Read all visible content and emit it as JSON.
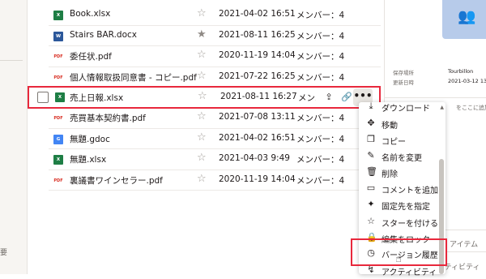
{
  "left_panel": {
    "stub_text": "要"
  },
  "files": [
    {
      "name": "Book.xlsx",
      "type": "xlsx",
      "type_label": "X",
      "starred": false,
      "date": "2021-04-02 16:51",
      "members": "メンバー：4"
    },
    {
      "name": "Stairs BAR.docx",
      "type": "docx",
      "type_label": "W",
      "starred": true,
      "date": "2021-08-11 16:25",
      "members": "メンバー：4"
    },
    {
      "name": "委任状.pdf",
      "type": "pdf",
      "type_label": "PDF",
      "starred": false,
      "date": "2020-11-19 14:04",
      "members": "メンバー：4"
    },
    {
      "name": "個人情報取扱同意書 - コピー.pdf",
      "type": "pdf",
      "type_label": "PDF",
      "starred": false,
      "date": "2021-07-22 16:25",
      "members": "メンバー：4"
    },
    {
      "name": "売上日報.xlsx",
      "type": "xlsx",
      "type_label": "X",
      "starred": false,
      "date": "2021-08-11 16:27",
      "members": "メンバー：4",
      "active": true
    },
    {
      "name": "売買基本契約書.pdf",
      "type": "pdf",
      "type_label": "PDF",
      "starred": false,
      "date": "2021-07-08 13:11",
      "members": "メンバー：4"
    },
    {
      "name": "無題.gdoc",
      "type": "gdoc",
      "type_label": "G",
      "starred": false,
      "date": "2021-04-02 16:51",
      "members": "メンバー：4"
    },
    {
      "name": "無題.xlsx",
      "type": "xlsx",
      "type_label": "X",
      "starred": false,
      "date": "2021-04-03 9:49",
      "members": "メンバー：4"
    },
    {
      "name": "裏議書ワインセラー.pdf",
      "type": "pdf",
      "type_label": "PDF",
      "starred": false,
      "date": "2020-11-19 14:04",
      "members": "メンバー：4"
    }
  ],
  "row_actions": {
    "share_icon": "share-icon",
    "link_icon": "link-icon",
    "more_label": "•••"
  },
  "menu": {
    "items": [
      {
        "icon": "download-icon",
        "glyph": "⤓",
        "label": "ダウンロード"
      },
      {
        "icon": "move-icon",
        "glyph": "✥",
        "label": "移動"
      },
      {
        "icon": "copy-icon",
        "glyph": "❐",
        "label": "コピー"
      },
      {
        "icon": "rename-icon",
        "glyph": "✎",
        "label": "名前を変更"
      },
      {
        "icon": "trash-icon",
        "glyph": "🗑",
        "label": "削除"
      },
      {
        "icon": "comment-icon",
        "glyph": "▭",
        "label": "コメントを追加"
      },
      {
        "icon": "pin-icon",
        "glyph": "✦",
        "label": "固定先を指定"
      },
      {
        "icon": "star-icon",
        "glyph": "☆",
        "label": "スターを付ける"
      },
      {
        "icon": "lock-icon",
        "glyph": "🔒",
        "label": "編集をロック"
      },
      {
        "icon": "history-icon",
        "glyph": "◷",
        "label": "バージョン履歴"
      },
      {
        "icon": "activity-icon",
        "glyph": "↯",
        "label": "アクティビティ"
      }
    ]
  },
  "right_panel": {
    "save_location_label": "保存場所",
    "save_location_value": "Tourbillon",
    "updated_label": "更新日時",
    "updated_value": "2021-03-12 13",
    "add_text": "をここに追加",
    "items_text": "アイテム",
    "activity_text": "アクティビティ"
  },
  "colors": {
    "highlight": "#e8283c",
    "avatar_bg": "#b7cbea"
  }
}
